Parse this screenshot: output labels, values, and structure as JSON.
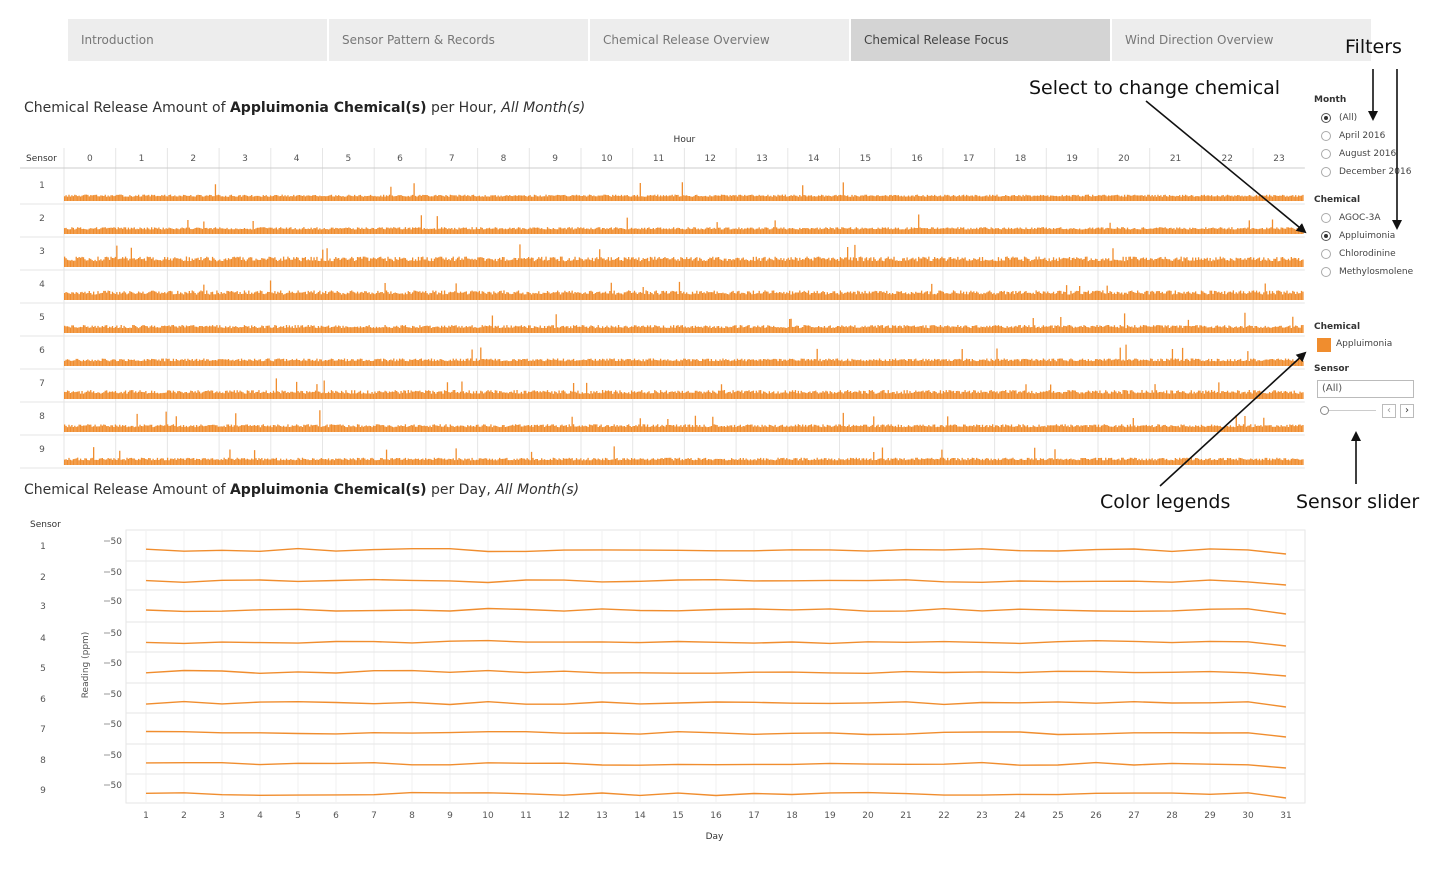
{
  "tabs": [
    {
      "label": "Introduction",
      "active": false
    },
    {
      "label": "Sensor Pattern & Records",
      "active": false
    },
    {
      "label": "Chemical Release Overview",
      "active": false
    },
    {
      "label": "Chemical Release Focus",
      "active": true
    },
    {
      "label": "Wind Direction Overview",
      "active": false
    }
  ],
  "hourly": {
    "title_pre": "Chemical Release Amount of ",
    "title_bold": "Appluimonia Chemical(s)",
    "title_mid": " per Hour, ",
    "title_italic": "All Month(s)",
    "column_header": "Hour",
    "row_header": "Sensor",
    "hours": [
      "0",
      "1",
      "2",
      "3",
      "4",
      "5",
      "6",
      "7",
      "8",
      "9",
      "10",
      "11",
      "12",
      "13",
      "14",
      "15",
      "16",
      "17",
      "18",
      "19",
      "20",
      "21",
      "22",
      "23"
    ],
    "sensors": [
      "1",
      "2",
      "3",
      "4",
      "5",
      "6",
      "7",
      "8",
      "9"
    ],
    "sensor_levels": [
      0.28,
      0.32,
      0.62,
      0.55,
      0.42,
      0.38,
      0.5,
      0.4,
      0.36
    ]
  },
  "daily": {
    "title_pre": "Chemical Release Amount of ",
    "title_bold": "Appluimonia Chemical(s)",
    "title_mid": " per Day, ",
    "title_italic": "All Month(s)",
    "row_header": "Sensor",
    "x_label": "Day",
    "y_axis_title": "Reading (ppm)",
    "y_tick": "50",
    "sensors": [
      "1",
      "2",
      "3",
      "4",
      "5",
      "6",
      "7",
      "8",
      "9"
    ],
    "days": [
      "1",
      "2",
      "3",
      "4",
      "5",
      "6",
      "7",
      "8",
      "9",
      "10",
      "11",
      "12",
      "13",
      "14",
      "15",
      "16",
      "17",
      "18",
      "19",
      "20",
      "21",
      "22",
      "23",
      "24",
      "25",
      "26",
      "27",
      "28",
      "29",
      "30",
      "31"
    ]
  },
  "filters": {
    "month_label": "Month",
    "month_options": [
      "(All)",
      "April 2016",
      "August 2016",
      "December 2016"
    ],
    "month_selected": 0,
    "chemical_label": "Chemical",
    "chemical_options": [
      "AGOC-3A",
      "Appluimonia",
      "Chlorodinine",
      "Methylosmolene"
    ],
    "chemical_selected": 1,
    "legend_label": "Chemical",
    "legend_item": "Appluimonia",
    "sensor_label": "Sensor",
    "sensor_value": "(All)"
  },
  "annotations": {
    "filters": "Filters",
    "select_chemical": "Select to change chemical",
    "color_legends": "Color legends",
    "sensor_slider": "Sensor slider"
  },
  "colors": {
    "series": "#f08d2e",
    "grid": "#e6e6e6",
    "tab_active": "#d4d4d4",
    "tab": "#ededed"
  }
}
